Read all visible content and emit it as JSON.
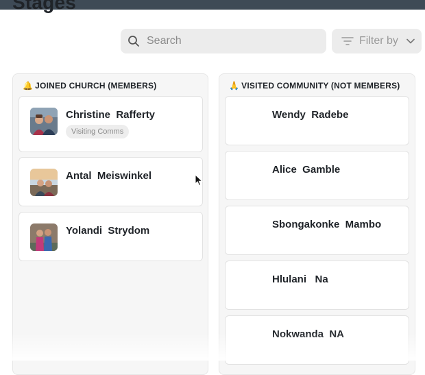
{
  "page": {
    "title": "Stages"
  },
  "search": {
    "placeholder": "Search"
  },
  "filter": {
    "label": "Filter by"
  },
  "columns": [
    {
      "emoji": "🔔",
      "title": "JOINED CHURCH (MEMBERS)",
      "cards": [
        {
          "name": "Christine  Rafferty",
          "tag": "Visiting Comms"
        },
        {
          "name": "Antal  Meiswinkel"
        },
        {
          "name": "Yolandi  Strydom"
        }
      ]
    },
    {
      "emoji": "🙏",
      "title": "VISITED COMMUNITY (NOT MEMBERS)",
      "cards": [
        {
          "name": "Wendy  Radebe"
        },
        {
          "name": "Alice  Gamble"
        },
        {
          "name": "Sbongakonke  Mambo"
        },
        {
          "name": "Hlulani   Na"
        },
        {
          "name": "Nokwanda  NA"
        }
      ]
    }
  ],
  "colors": {
    "topbar": "#3e4a56",
    "control_bg": "#ececec",
    "column_bg": "#f6f6f6"
  },
  "icons": [
    "search-icon",
    "filter-icon",
    "chevron-down-icon",
    "bell-icon",
    "praying-hands-icon",
    "mouse-cursor-icon"
  ]
}
